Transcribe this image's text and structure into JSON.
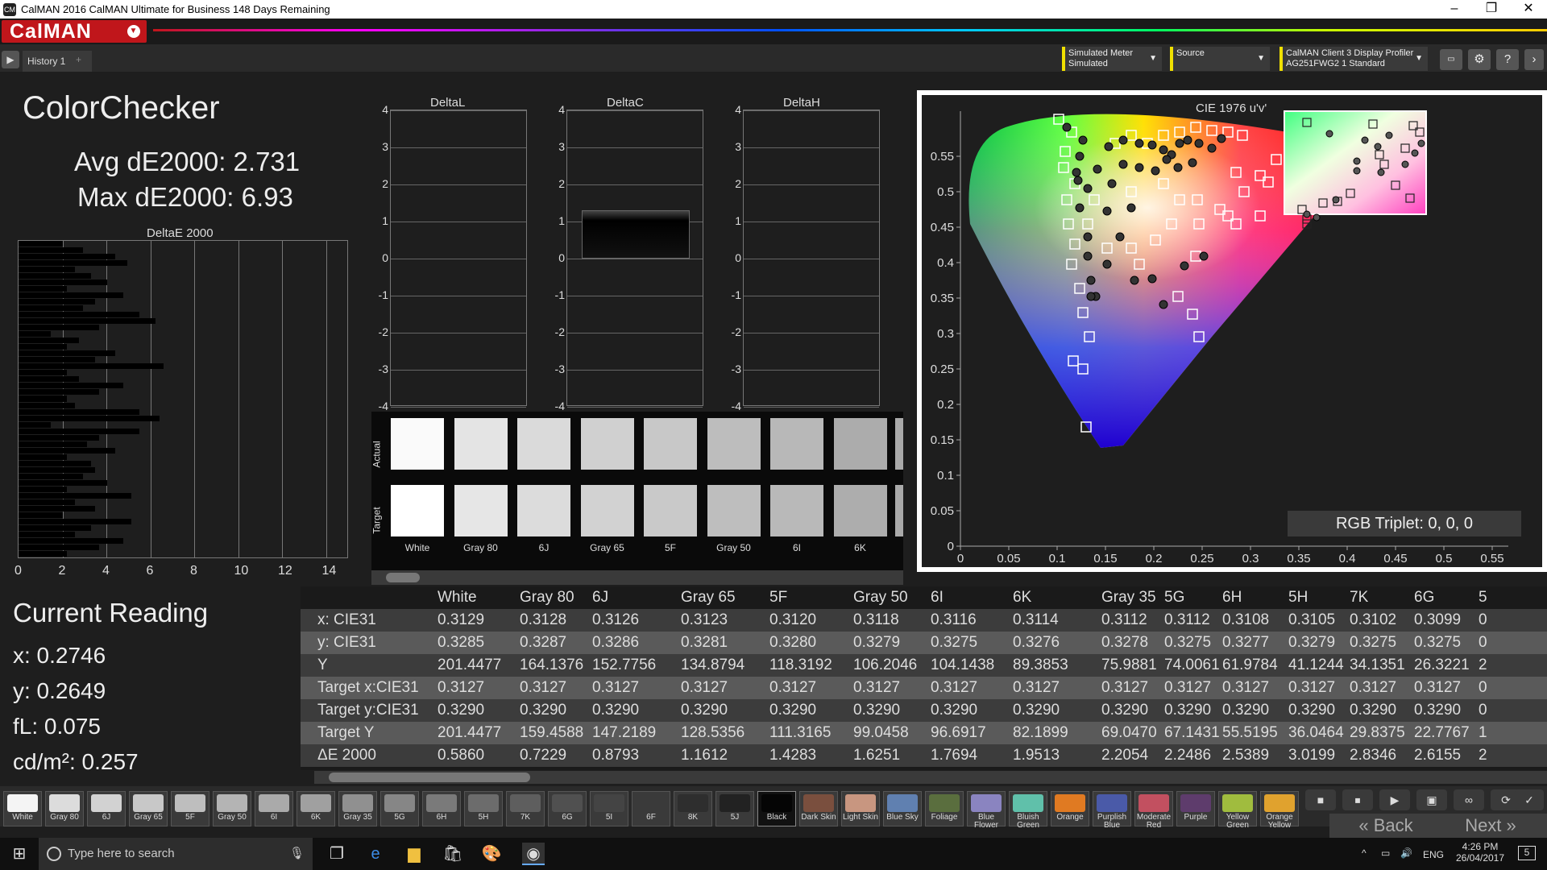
{
  "window": {
    "title": "CalMAN 2016 CalMAN Ultimate for Business 148 Days Remaining",
    "icon": "CM"
  },
  "app": {
    "logo": "CalMAN",
    "tab": "History 1",
    "add_tab": "+"
  },
  "toolbar": {
    "meter": {
      "line1": "Simulated Meter",
      "line2": "Simulated"
    },
    "source": {
      "line1": "Source"
    },
    "display": {
      "line1": "CalMAN Client 3 Display Profiler",
      "line2": "AG251FWG2 1 Standard"
    },
    "icons": [
      "pattern-icon",
      "gear-icon",
      "help-icon",
      "chevron-right-icon"
    ]
  },
  "colorchecker": {
    "title": "ColorChecker",
    "avg": "Avg dE2000: 2.731",
    "max": "Max dE2000: 6.93",
    "hist_title": "DeltaE 2000",
    "hist_axis": [
      "0",
      "2",
      "4",
      "6",
      "8",
      "10",
      "12",
      "14"
    ]
  },
  "delta_charts": [
    {
      "title": "DeltaL",
      "bar": 0
    },
    {
      "title": "DeltaC",
      "bar": 1.3
    },
    {
      "title": "DeltaH",
      "bar": 0
    }
  ],
  "delta_ticks": [
    "4",
    "3",
    "2",
    "1",
    "0",
    "-1",
    "-2",
    "-3",
    "-4"
  ],
  "swatches": {
    "actual_label": "Actual",
    "target_label": "Target",
    "items": [
      {
        "name": "White",
        "actual": "#fafafa",
        "target": "#ffffff"
      },
      {
        "name": "Gray 80",
        "actual": "#e4e4e4",
        "target": "#e6e6e6"
      },
      {
        "name": "6J",
        "actual": "#dadada",
        "target": "#dcdcdc"
      },
      {
        "name": "Gray 65",
        "actual": "#d0d0d0",
        "target": "#d2d2d2"
      },
      {
        "name": "5F",
        "actual": "#c8c8c8",
        "target": "#c9c9c9"
      },
      {
        "name": "Gray 50",
        "actual": "#bdbdbd",
        "target": "#bebebe"
      },
      {
        "name": "6I",
        "actual": "#b8b8b8",
        "target": "#b9b9b9"
      },
      {
        "name": "6K",
        "actual": "#acacac",
        "target": "#adadad"
      }
    ]
  },
  "cie": {
    "title": "CIE 1976 u'v'",
    "rgb_triplet": "RGB Triplet: 0, 0, 0",
    "xticks": [
      "0",
      "0.05",
      "0.1",
      "0.15",
      "0.2",
      "0.25",
      "0.3",
      "0.35",
      "0.4",
      "0.45",
      "0.5",
      "0.55"
    ],
    "yticks": [
      "0.55",
      "0.5",
      "0.45",
      "0.4",
      "0.35",
      "0.3",
      "0.25",
      "0.2",
      "0.15",
      "0.1",
      "0.05",
      "0"
    ]
  },
  "current": {
    "title": "Current Reading",
    "x": "x: 0.2746",
    "y": "y: 0.2649",
    "fl": "fL: 0.075",
    "cdm2": "cd/m²: 0.257"
  },
  "table": {
    "columns": [
      "White",
      "Gray 80",
      "6J",
      "Gray 65",
      "5F",
      "Gray 50",
      "6I",
      "6K",
      "Gray 35",
      "5G",
      "6H",
      "5H",
      "7K",
      "6G",
      "5"
    ],
    "rows": [
      {
        "label": "x: CIE31",
        "values": [
          "0.3129",
          "0.3128",
          "0.3126",
          "0.3123",
          "0.3120",
          "0.3118",
          "0.3116",
          "0.3114",
          "0.3112",
          "0.3112",
          "0.3108",
          "0.3105",
          "0.3102",
          "0.3099",
          "0"
        ]
      },
      {
        "label": "y: CIE31",
        "values": [
          "0.3285",
          "0.3287",
          "0.3286",
          "0.3281",
          "0.3280",
          "0.3279",
          "0.3275",
          "0.3276",
          "0.3278",
          "0.3275",
          "0.3277",
          "0.3279",
          "0.3275",
          "0.3275",
          "0"
        ]
      },
      {
        "label": "Y",
        "values": [
          "201.4477",
          "164.1376",
          "152.7756",
          "134.8794",
          "118.3192",
          "106.2046",
          "104.1438",
          "89.3853",
          "75.9881",
          "74.0061",
          "61.9784",
          "41.1244",
          "34.1351",
          "26.3221",
          "2"
        ]
      },
      {
        "label": "Target x:CIE31",
        "values": [
          "0.3127",
          "0.3127",
          "0.3127",
          "0.3127",
          "0.3127",
          "0.3127",
          "0.3127",
          "0.3127",
          "0.3127",
          "0.3127",
          "0.3127",
          "0.3127",
          "0.3127",
          "0.3127",
          "0"
        ]
      },
      {
        "label": "Target y:CIE31",
        "values": [
          "0.3290",
          "0.3290",
          "0.3290",
          "0.3290",
          "0.3290",
          "0.3290",
          "0.3290",
          "0.3290",
          "0.3290",
          "0.3290",
          "0.3290",
          "0.3290",
          "0.3290",
          "0.3290",
          "0"
        ]
      },
      {
        "label": "Target Y",
        "values": [
          "201.4477",
          "159.4588",
          "147.2189",
          "128.5356",
          "111.3165",
          "99.0458",
          "96.6917",
          "82.1899",
          "69.0470",
          "67.1431",
          "55.5195",
          "36.0464",
          "29.8375",
          "22.7767",
          "1"
        ]
      },
      {
        "label": "ΔE 2000",
        "values": [
          "0.5860",
          "0.7229",
          "0.8793",
          "1.1612",
          "1.4283",
          "1.6251",
          "1.7694",
          "1.9513",
          "2.2054",
          "2.2486",
          "2.5389",
          "3.0199",
          "2.8346",
          "2.6155",
          "2"
        ]
      }
    ]
  },
  "bottom_swatches": [
    {
      "label": "White",
      "color": "#f4f4f4"
    },
    {
      "label": "Gray 80",
      "color": "#dcdcdc"
    },
    {
      "label": "6J",
      "color": "#d2d2d2"
    },
    {
      "label": "Gray 65",
      "color": "#c8c8c8"
    },
    {
      "label": "5F",
      "color": "#bebebe"
    },
    {
      "label": "Gray 50",
      "color": "#b4b4b4"
    },
    {
      "label": "6I",
      "color": "#aaaaaa"
    },
    {
      "label": "6K",
      "color": "#a0a0a0"
    },
    {
      "label": "Gray 35",
      "color": "#909090"
    },
    {
      "label": "5G",
      "color": "#868686"
    },
    {
      "label": "6H",
      "color": "#7a7a7a"
    },
    {
      "label": "5H",
      "color": "#6c6c6c"
    },
    {
      "label": "7K",
      "color": "#5e5e5e"
    },
    {
      "label": "6G",
      "color": "#505050"
    },
    {
      "label": "5I",
      "color": "#444444"
    },
    {
      "label": "6F",
      "color": "#3a3a3a"
    },
    {
      "label": "8K",
      "color": "#2e2e2e"
    },
    {
      "label": "5J",
      "color": "#222222"
    },
    {
      "label": "Black",
      "color": "#050505"
    },
    {
      "label": "Dark Skin",
      "color": "#7a4f3e"
    },
    {
      "label": "Light Skin",
      "color": "#c89680"
    },
    {
      "label": "Blue Sky",
      "color": "#6080b0"
    },
    {
      "label": "Foliage",
      "color": "#5a6e3e"
    },
    {
      "label": "Blue Flower",
      "color": "#8a84c0"
    },
    {
      "label": "Bluish Green",
      "color": "#60c0aa"
    },
    {
      "label": "Orange",
      "color": "#e07a22"
    },
    {
      "label": "Purplish Blue",
      "color": "#4a5aa8"
    },
    {
      "label": "Moderate Red",
      "color": "#c25060"
    },
    {
      "label": "Purple",
      "color": "#5e3c6c"
    },
    {
      "label": "Yellow Green",
      "color": "#a0bc3e"
    },
    {
      "label": "Orange Yellow",
      "color": "#e0a22e"
    }
  ],
  "nav": {
    "back": "Back",
    "next": "Next"
  },
  "taskbar": {
    "search_placeholder": "Type here to search",
    "lang": "ENG",
    "time": "4:26 PM",
    "date": "26/04/2017",
    "notif": "5"
  }
}
